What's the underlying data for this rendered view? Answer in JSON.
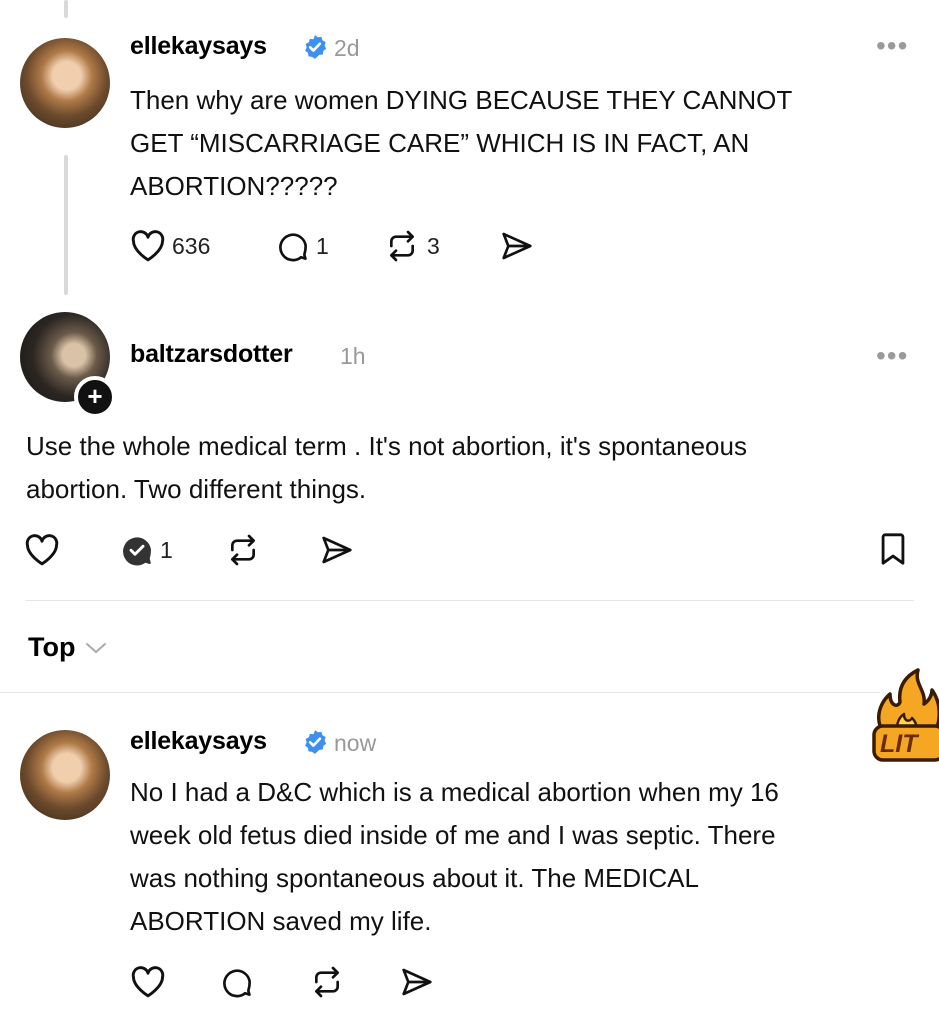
{
  "post1": {
    "username": "ellekaysays",
    "time": "2d",
    "lines": [
      "Then why are women DYING BECAUSE THEY CANNOT",
      "GET “MISCARRIAGE CARE” WHICH IS IN FACT, AN",
      "ABORTION?????"
    ],
    "likes": "636",
    "replies": "1",
    "reposts": "3"
  },
  "post2": {
    "username": "baltzarsdotter",
    "time": "1h",
    "lines": [
      "Use the whole medical term . It's not abortion, it's spontaneous",
      "abortion. Two different things."
    ],
    "replies": "1"
  },
  "sort": {
    "label": "Top"
  },
  "post3": {
    "username": "ellekaysays",
    "time": "now",
    "lines": [
      "No I had a D&C which is a medical abortion when my 16",
      "week old fetus died inside of me and I was septic. There",
      "was nothing spontaneous about it. The MEDICAL",
      "ABORTION saved my life."
    ]
  },
  "sticker": {
    "label": "LIT"
  },
  "icons": {
    "more": "more-icon",
    "verified": "verified-badge-icon",
    "like": "heart-icon",
    "reply": "reply-icon",
    "repost": "repost-icon",
    "share": "send-icon",
    "save": "bookmark-icon",
    "chevron": "chevron-down-icon",
    "follow": "plus-icon"
  },
  "colors": {
    "verified": "#3d8ff0",
    "muted": "#999999",
    "sticker_fill": "#f5a623",
    "sticker_text": "#6b2c00"
  }
}
